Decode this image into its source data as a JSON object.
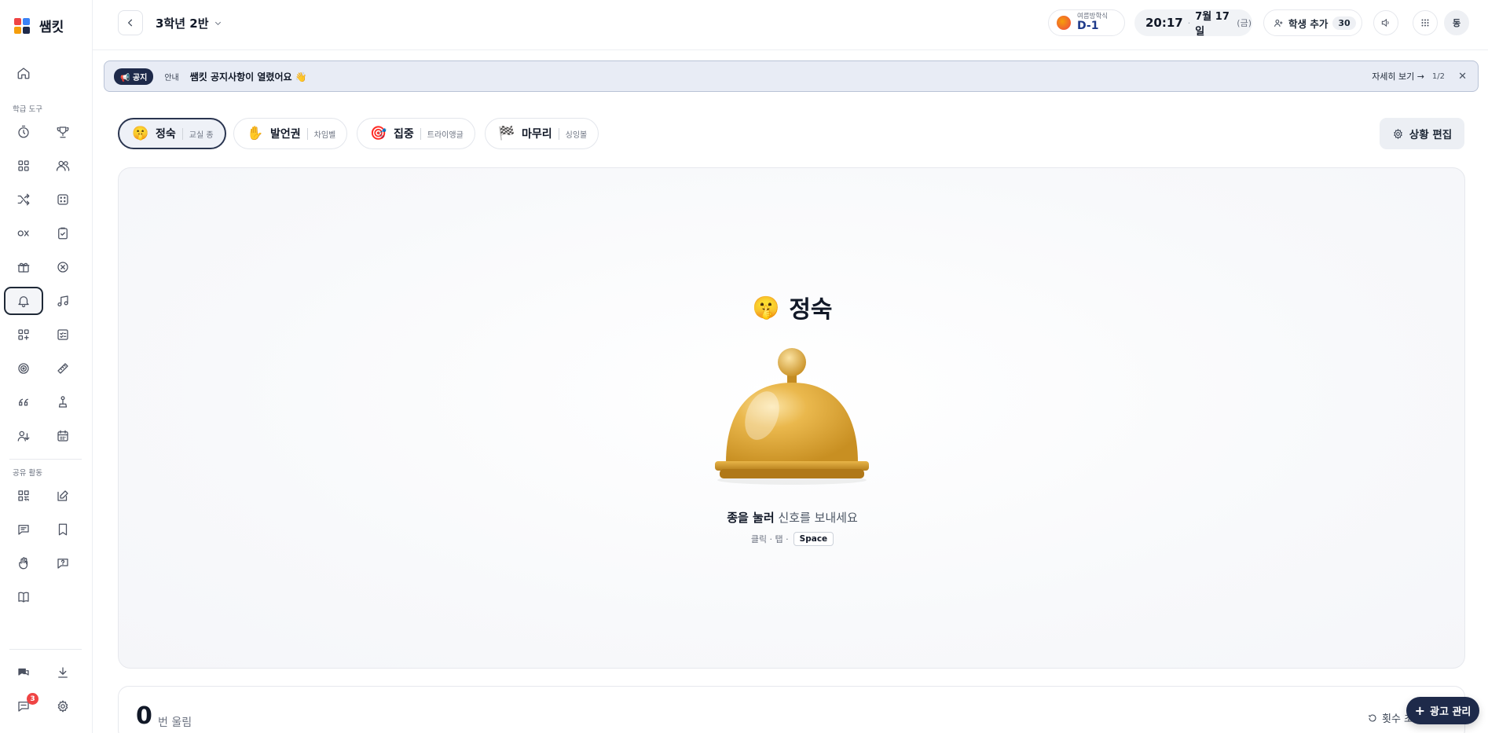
{
  "brand": {
    "name": "쌤킷"
  },
  "sidebar": {
    "section_tools": "학급 도구",
    "section_shared": "공유 활동",
    "chat_badge": "3"
  },
  "header": {
    "class_name": "3학년 2반",
    "dday_label": "여름방학식",
    "dday_value": "D-1",
    "time": "20:17",
    "date": "7월 17일",
    "day_of_week": "(금)",
    "add_student_label": "학생 추가",
    "student_count": "30",
    "avatar_initial": "동"
  },
  "notice": {
    "tag": "📢 공지",
    "kind": "안내",
    "text": "쌤킷 공지사항이 열렸어요 👋",
    "more": "자세히 보기 →",
    "page": "1/2",
    "close": "✕"
  },
  "tabs": [
    {
      "emoji": "🤫",
      "label": "정숙",
      "sub": "교실 종"
    },
    {
      "emoji": "✋",
      "label": "발언권",
      "sub": "차임벨"
    },
    {
      "emoji": "🎯",
      "label": "집중",
      "sub": "트라이앵글"
    },
    {
      "emoji": "🏁",
      "label": "마무리",
      "sub": "싱잉볼"
    }
  ],
  "edit_button": "상황 편집",
  "stage": {
    "emoji": "🤫",
    "title": "정숙",
    "cta_bold": "종을 눌러",
    "cta_rest": " 신호를 보내세요",
    "hint": "클릭 · 탭 ·",
    "key": "Space"
  },
  "counter": {
    "value": "0",
    "unit": "번 울림",
    "reset": "횟수 초"
  },
  "ad_button": "광고 관리",
  "colors": {
    "accent_dark": "#1e2a4a",
    "bell_gold": "#e0aa3c",
    "badge_red": "#ef4444"
  }
}
